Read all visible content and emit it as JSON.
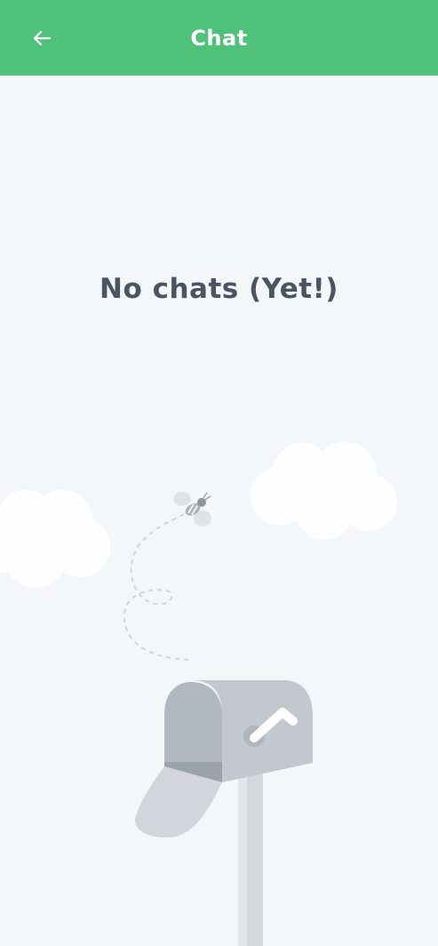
{
  "header": {
    "title": "Chat",
    "back_icon": "arrow-left-icon"
  },
  "empty_state": {
    "message": "No chats (Yet!)",
    "illustration": "mailbox-with-bee-illustration"
  },
  "colors": {
    "app_bar": "#4fc27a",
    "background": "#f4f7f9",
    "text": "#4a5561"
  }
}
